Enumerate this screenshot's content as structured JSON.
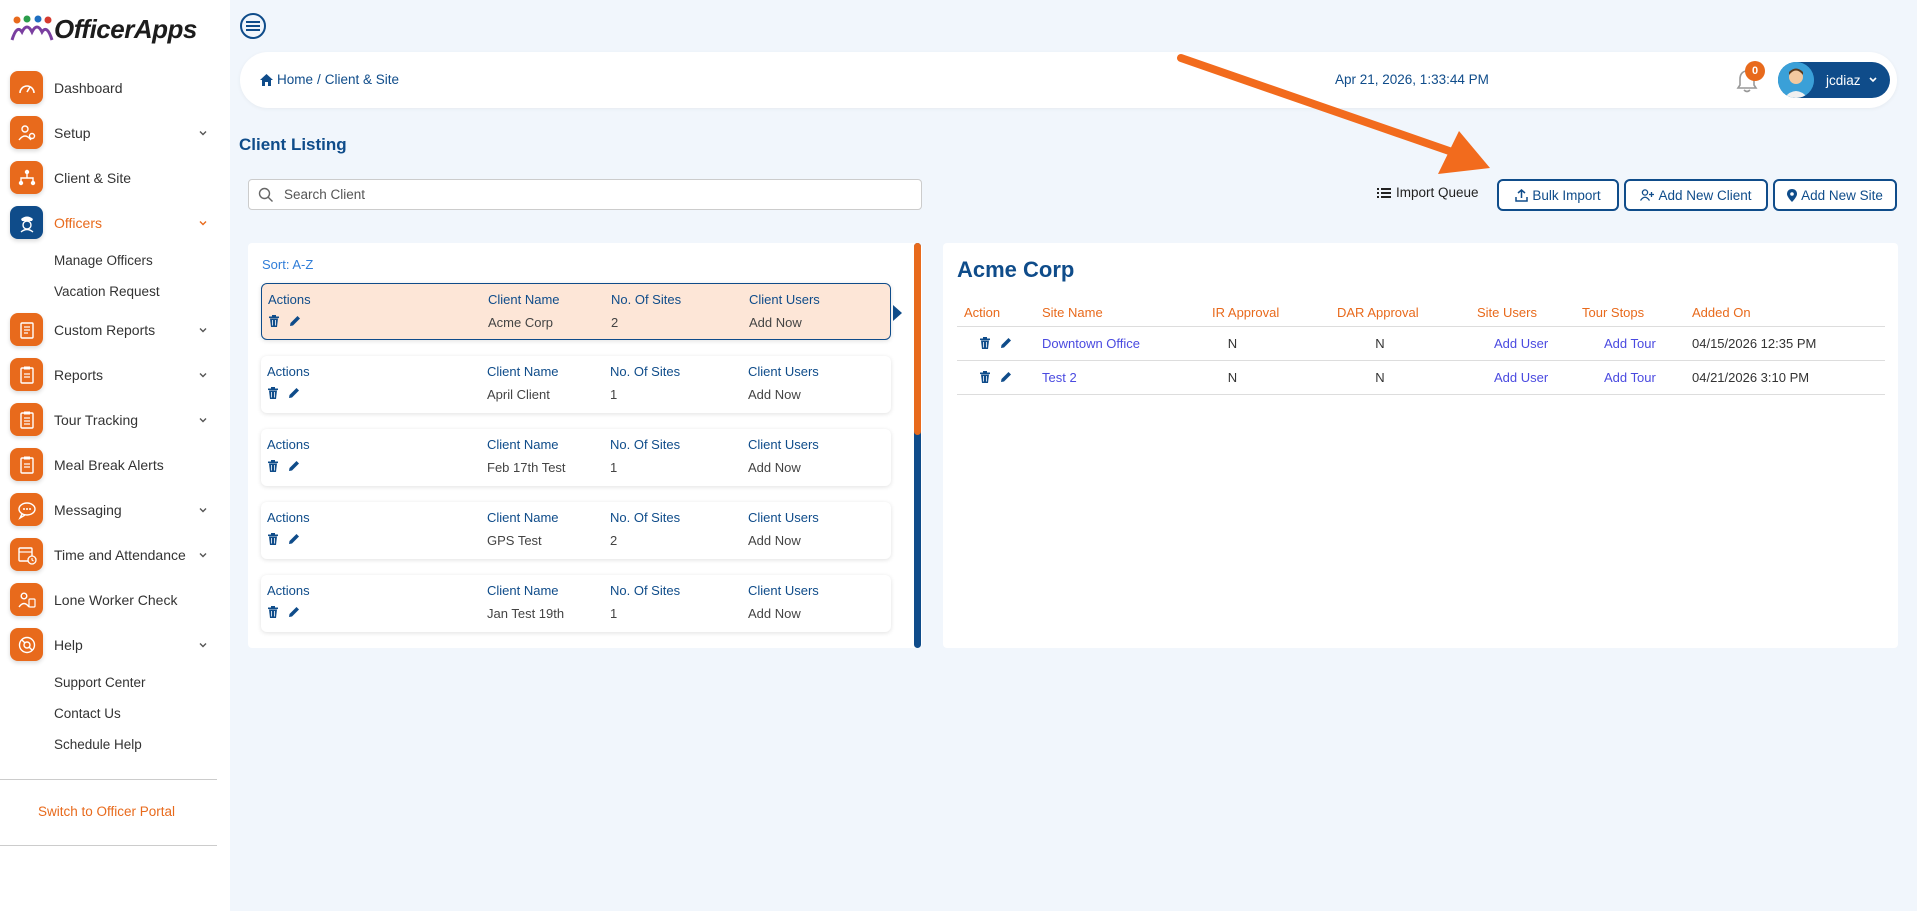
{
  "app": {
    "logo_text": "OfficerApps"
  },
  "sidebar": {
    "items": [
      {
        "label": "Dashboard",
        "icon": "speedometer-icon",
        "has_submenu": false
      },
      {
        "label": "Setup",
        "icon": "user-setup-icon",
        "has_submenu": true
      },
      {
        "label": "Client & Site",
        "icon": "org-chart-icon",
        "has_submenu": false
      },
      {
        "label": "Officers",
        "icon": "officer-badge-icon",
        "has_submenu": true,
        "active": true,
        "subitems": [
          "Manage Officers",
          "Vacation Request"
        ]
      },
      {
        "label": "Custom Reports",
        "icon": "custom-report-icon",
        "has_submenu": true
      },
      {
        "label": "Reports",
        "icon": "clipboard-icon",
        "has_submenu": true
      },
      {
        "label": "Tour Tracking",
        "icon": "clipboard-list-icon",
        "has_submenu": true
      },
      {
        "label": "Meal Break Alerts",
        "icon": "clipboard-alert-icon",
        "has_submenu": false
      },
      {
        "label": "Messaging",
        "icon": "chat-bubble-icon",
        "has_submenu": true
      },
      {
        "label": "Time and Attendance",
        "icon": "calendar-clock-icon",
        "has_submenu": true
      },
      {
        "label": "Lone Worker Check",
        "icon": "lone-worker-icon",
        "has_submenu": false
      },
      {
        "label": "Help",
        "icon": "help-support-icon",
        "has_submenu": true,
        "subitems": [
          "Support Center",
          "Contact Us",
          "Schedule Help"
        ]
      }
    ],
    "switch_portal": "Switch to Officer Portal"
  },
  "header": {
    "breadcrumb_home": "Home",
    "breadcrumb_sep": "/",
    "breadcrumb_current": "Client & Site",
    "datetime": "Apr 21, 2026, 1:33:44 PM",
    "notification_count": "0",
    "username": "jcdiaz"
  },
  "page": {
    "title": "Client Listing",
    "search_placeholder": "Search Client",
    "import_queue": "Import Queue",
    "bulk_import": "Bulk Import",
    "add_new_client": "Add New Client",
    "add_new_site": "Add New Site"
  },
  "client_list": {
    "sort_label": "Sort: A-Z",
    "headers": {
      "actions": "Actions",
      "client_name": "Client Name",
      "sites": "No. Of Sites",
      "users": "Client Users"
    },
    "rows": [
      {
        "name": "Acme Corp",
        "sites": "2",
        "users": "Add Now",
        "selected": true
      },
      {
        "name": "April Client",
        "sites": "1",
        "users": "Add Now"
      },
      {
        "name": "Feb 17th Test",
        "sites": "1",
        "users": "Add Now"
      },
      {
        "name": "GPS Test",
        "sites": "2",
        "users": "Add Now"
      },
      {
        "name": "Jan Test 19th",
        "sites": "1",
        "users": "Add Now"
      }
    ]
  },
  "detail": {
    "client_name": "Acme Corp",
    "headers": [
      "Action",
      "Site Name",
      "IR Approval",
      "DAR Approval",
      "Site Users",
      "Tour Stops",
      "Added On"
    ],
    "rows": [
      {
        "site": "Downtown Office",
        "ir": "N",
        "dar": "N",
        "users": "Add User",
        "tour": "Add Tour",
        "added": "04/15/2026 12:35 PM"
      },
      {
        "site": "Test 2",
        "ir": "N",
        "dar": "N",
        "users": "Add User",
        "tour": "Add Tour",
        "added": "04/21/2026 3:10 PM"
      }
    ]
  },
  "colors": {
    "primary": "#0f4c8a",
    "accent": "#e86a1c",
    "link": "#4a4ae0",
    "background": "#f1f6fc"
  }
}
